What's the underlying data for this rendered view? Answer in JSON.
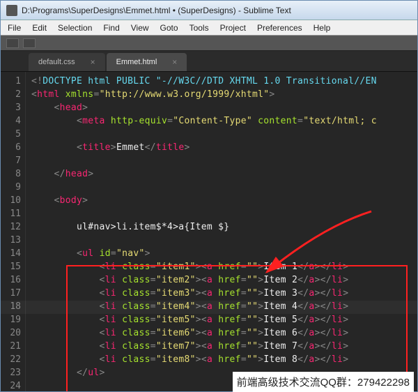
{
  "window": {
    "title": "D:\\Programs\\SuperDesigns\\Emmet.html • (SuperDesigns) - Sublime Text"
  },
  "menu": [
    "File",
    "Edit",
    "Selection",
    "Find",
    "View",
    "Goto",
    "Tools",
    "Project",
    "Preferences",
    "Help"
  ],
  "tabs": [
    {
      "label": "default.css",
      "active": false
    },
    {
      "label": "Emmet.html",
      "active": true
    }
  ],
  "lines": [
    1,
    2,
    3,
    4,
    5,
    6,
    7,
    8,
    9,
    10,
    11,
    12,
    13,
    14,
    15,
    16,
    17,
    18,
    19,
    20,
    21,
    22,
    23,
    24
  ],
  "emmet": "ul#nav>li.item$*4>a{Item $}",
  "code_text": {
    "doctype": "DOCTYPE html PUBLIC \"-//W3C//DTD XHTML 1.0 Transitional//EN",
    "xmlns": "http://www.w3.org/1999/xhtml",
    "meta_key": "http-equiv",
    "meta_val": "Content-Type",
    "meta_content_k": "content",
    "meta_content_v": "text/html; c",
    "title_text": "Emmet"
  },
  "items": [
    {
      "cls": "item1",
      "txt": "Item 1"
    },
    {
      "cls": "item2",
      "txt": "Item 2"
    },
    {
      "cls": "item3",
      "txt": "Item 3"
    },
    {
      "cls": "item4",
      "txt": "Item 4"
    },
    {
      "cls": "item5",
      "txt": "Item 5"
    },
    {
      "cls": "item6",
      "txt": "Item 6"
    },
    {
      "cls": "item7",
      "txt": "Item 7"
    },
    {
      "cls": "item8",
      "txt": "Item 8"
    }
  ],
  "footer": "前端高级技术交流QQ群：279422298"
}
